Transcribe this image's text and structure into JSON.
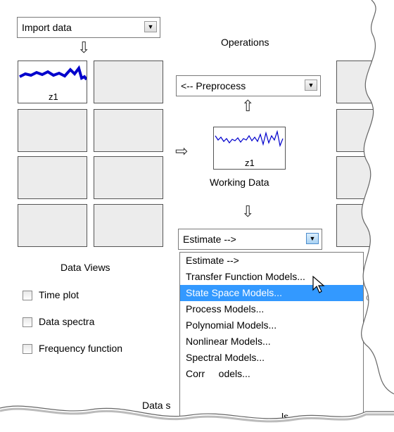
{
  "import_dropdown": {
    "value": "Import data"
  },
  "operations": {
    "title": "Operations"
  },
  "preprocess_dropdown": {
    "value": "<-- Preprocess"
  },
  "data_views": {
    "title": "Data Views",
    "slot_label": "z1",
    "checkboxes": [
      "Time plot",
      "Data spectra",
      "Frequency function"
    ]
  },
  "working_data": {
    "label": "Working Data",
    "slot_label": "z1"
  },
  "estimate_dropdown": {
    "value": "Estimate -->"
  },
  "estimate_menu": {
    "items": [
      "Estimate -->",
      "Transfer Function Models...",
      "State Space Models...",
      "Process Models...",
      "Polynomial Models...",
      "Nonlinear Models...",
      "Spectral Models...",
      "Corr     odels..."
    ],
    "highlighted_index": 2
  },
  "partial_texts": {
    "right_clip": "od",
    "bottom_left": "Data s",
    "bottom_right": "ls..."
  },
  "colors": {
    "highlight": "#3399ff",
    "plot_line": "#0000cc"
  }
}
